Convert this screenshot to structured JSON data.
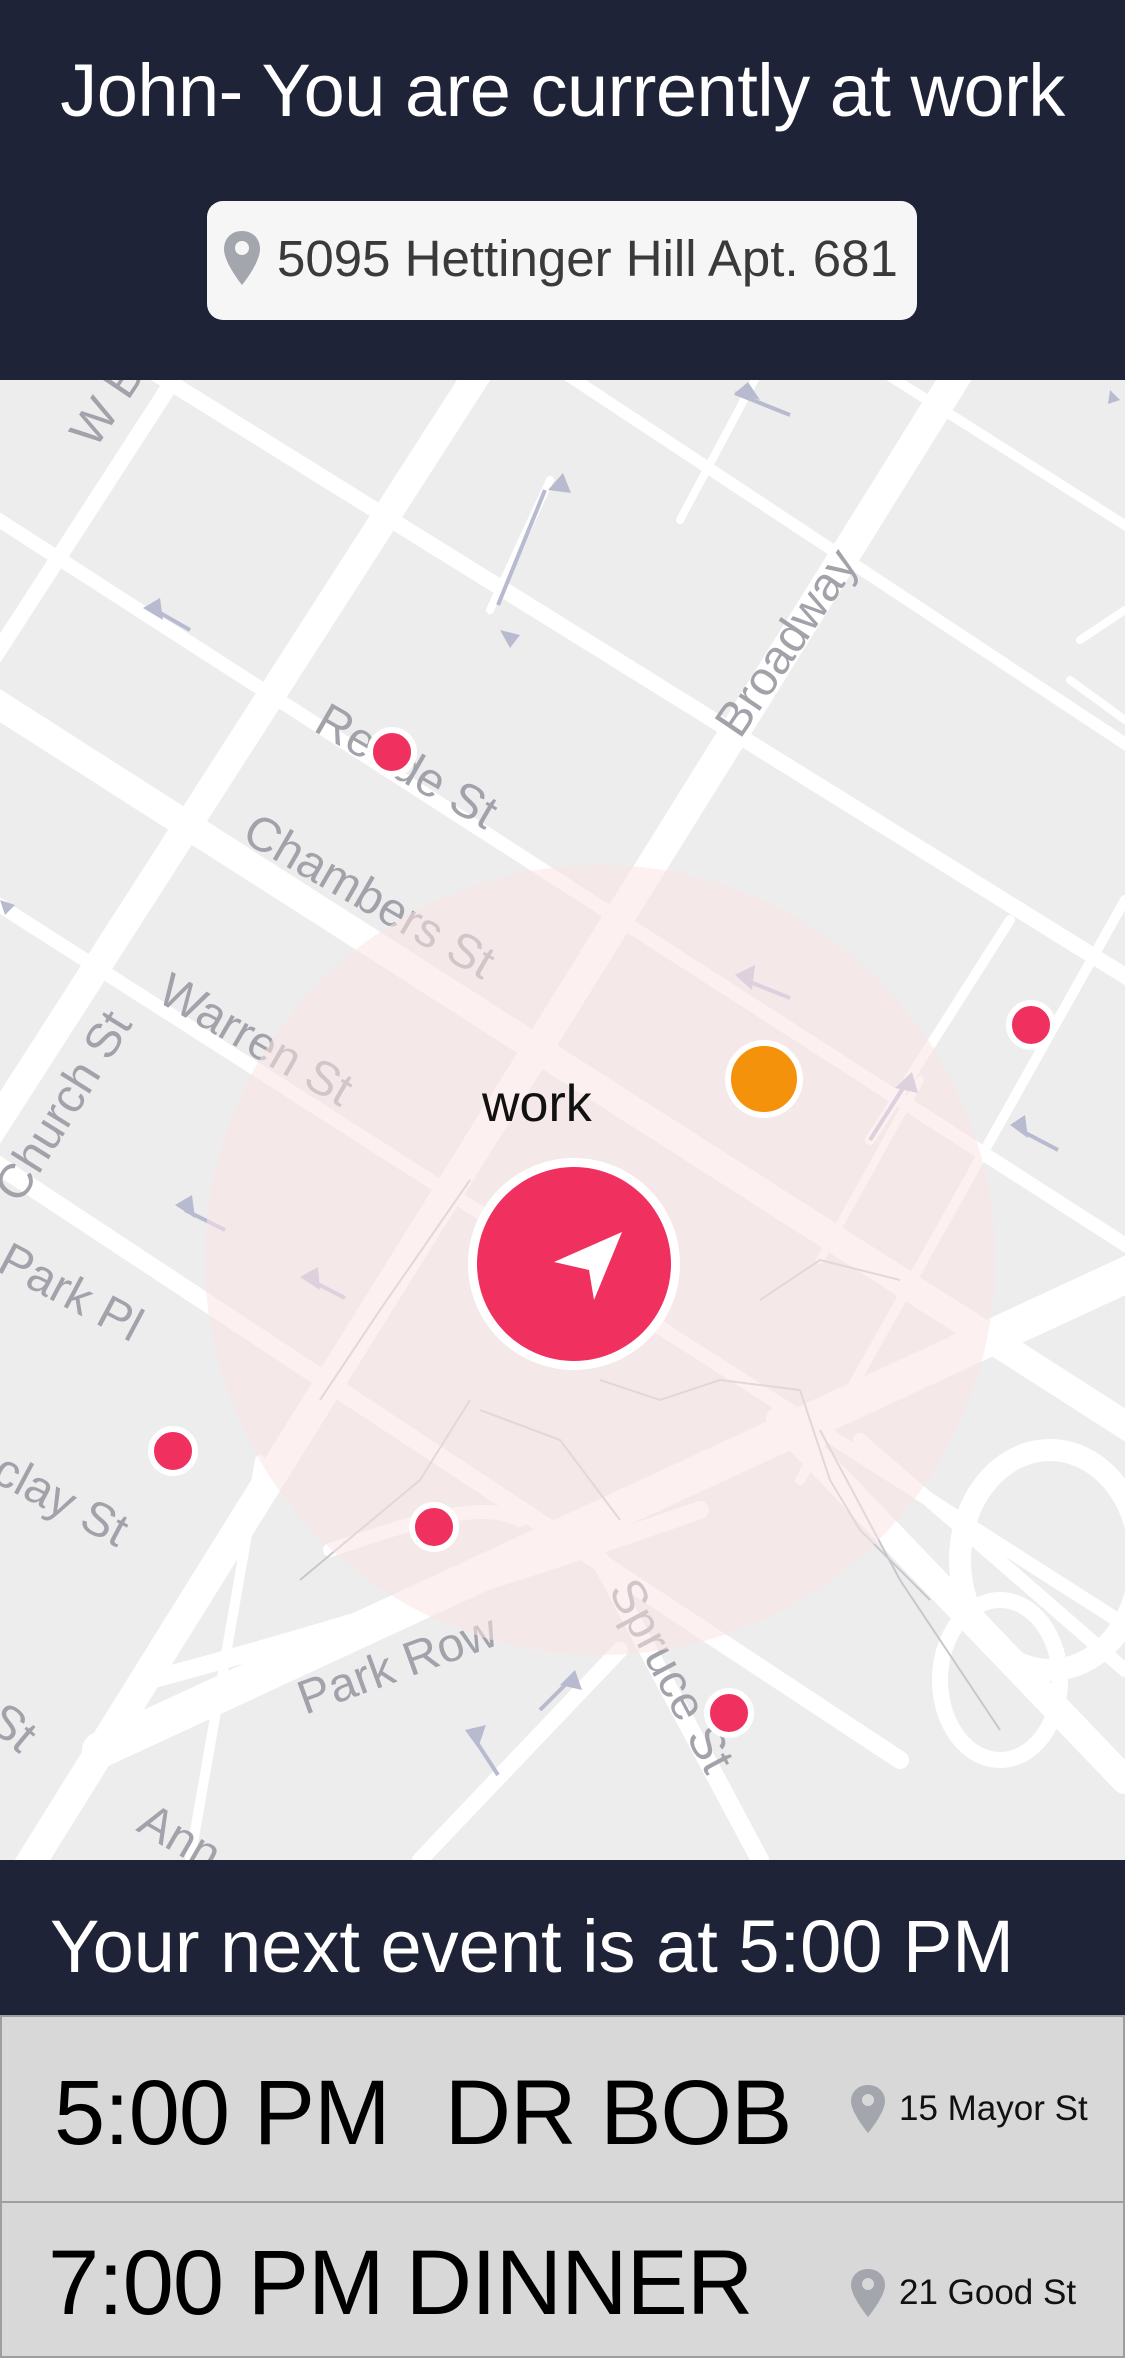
{
  "header": {
    "title": "John- You are currently at work",
    "address": "5095 Hettinger Hill Apt. 681",
    "address_icon": "location-pin-icon"
  },
  "map": {
    "location_label": "work",
    "navigation_icon": "navigation-arrow-icon",
    "street_labels": [
      "W B",
      "Broadway",
      "Reade St",
      "Chambers St",
      "Warren St",
      "Church St",
      "Park Pl",
      "clay St",
      "Park Row",
      "Spruce St",
      "Ann",
      "St"
    ],
    "colors": {
      "marker_red": "#f0305e",
      "marker_orange": "#f5920b",
      "zone_fill": "#fae4e6",
      "road": "#ffffff",
      "land": "#ededee",
      "street_label": "#9c9ca6"
    }
  },
  "next_event_banner": "Your next event is at 5:00 PM",
  "events": [
    {
      "time": "5:00 PM",
      "name": "DR BOB",
      "location": "15 Mayor St",
      "icon": "location-pin-icon"
    },
    {
      "time": "7:00 PM",
      "name": "DINNER",
      "location": "21 Good St",
      "icon": "location-pin-icon"
    }
  ]
}
